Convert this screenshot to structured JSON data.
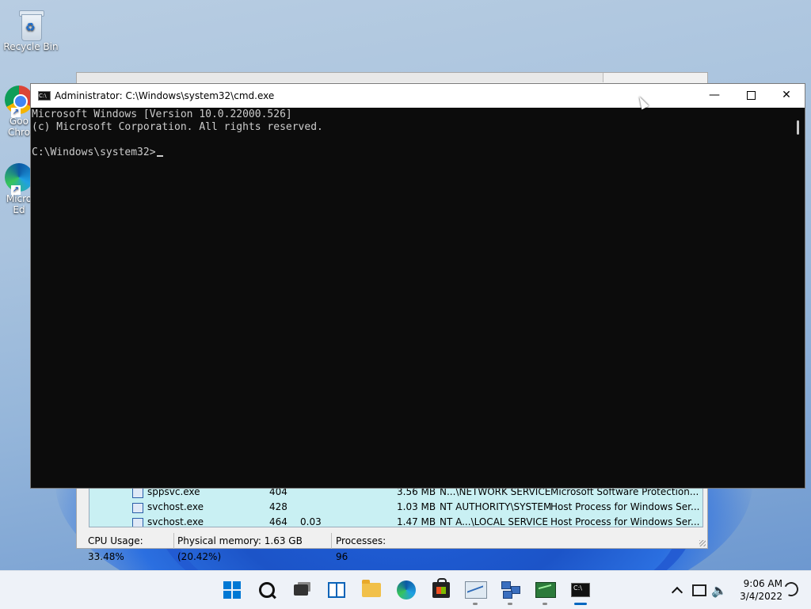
{
  "desktop": {
    "recycle_bin_label": "Recycle Bin",
    "chrome_label_1": "Goo",
    "chrome_label_2": "Chro",
    "edge_label_1": "Micro",
    "edge_label_2": "Ed"
  },
  "task_manager": {
    "rows": [
      {
        "name": "sppsvc.exe",
        "pid": "404",
        "cpu": "",
        "memory": "3.56 MB",
        "user": "N...\\NETWORK SERVICE",
        "description": "Microsoft Software Protection..."
      },
      {
        "name": "svchost.exe",
        "pid": "428",
        "cpu": "",
        "memory": "1.03 MB",
        "user": "NT AUTHORITY\\SYSTEM",
        "description": "Host Process for Windows Ser..."
      },
      {
        "name": "svchost.exe",
        "pid": "464",
        "cpu": "0.03",
        "memory": "1.47 MB",
        "user": "NT A...\\LOCAL SERVICE",
        "description": "Host Process for Windows Ser..."
      }
    ],
    "status": {
      "cpu": "CPU Usage: 33.48%",
      "memory": "Physical memory: 1.63 GB (20.42%)",
      "processes": "Processes: 96"
    }
  },
  "cmd": {
    "title": "Administrator: C:\\Windows\\system32\\cmd.exe",
    "icon_text": "C:\\",
    "lines": [
      "Microsoft Windows [Version 10.0.22000.526]",
      "(c) Microsoft Corporation. All rights reserved.",
      "",
      "C:\\Windows\\system32>"
    ],
    "minimize_glyph": "—",
    "close_glyph": "✕"
  },
  "taskbar": {
    "time": "9:06 AM",
    "date": "3/4/2022",
    "volume_glyph": "🔈",
    "cmd_icon_text": "C:\\"
  },
  "colors": {
    "accent": "#0078d4",
    "console_bg": "#0c0c0c",
    "console_fg": "#cccccc",
    "list_bg": "#c9f0f3"
  }
}
